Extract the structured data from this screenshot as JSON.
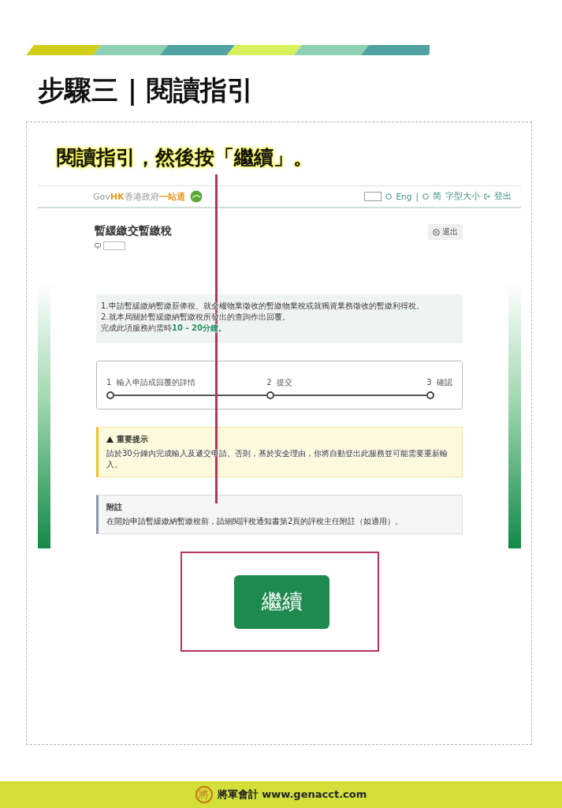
{
  "heading": "步驟三 | 閱讀指引",
  "callout": "閱讀指引，然後按「繼續」。",
  "site_header": {
    "logo": [
      {
        "text": "Gov",
        "highlight": false
      },
      {
        "text": "HK",
        "highlight": true
      },
      {
        "text": "香港政府",
        "highlight": false
      },
      {
        "text": "一站通",
        "highlight": true
      }
    ],
    "links": [
      {
        "kind": "lang",
        "label": "Eng"
      },
      {
        "kind": "sep",
        "label": "|"
      },
      {
        "kind": "lang",
        "label": "简"
      },
      {
        "kind": "font",
        "label": "字型大小"
      },
      {
        "kind": "logout",
        "label": "登出"
      }
    ]
  },
  "page": {
    "title": "暫緩繳交暫繳稅",
    "exit_button": "退出"
  },
  "info": {
    "lines": [
      "1.申請暫緩繳納暫繳薪俸稅、就全權物業徵收的暫繳物業稅或就獨資業務徵收的暫繳利得稅。",
      "2.就本局關於暫緩繳納暫繳稅所發出的查詢作出回覆。"
    ],
    "duration_prefix": "完成此項服務約需時",
    "duration": "10 - 20分鐘。"
  },
  "steps": [
    {
      "number": "1",
      "label": "輸入申請或回覆的詳情"
    },
    {
      "number": "2",
      "label": "提交"
    },
    {
      "number": "3",
      "label": "確認"
    }
  ],
  "warning": {
    "title": "重要提示",
    "text": "請於30分鐘內完成輸入及遞交申請。否則，基於安全理由，你將自動登出此服務並可能需要重新輸入。"
  },
  "note": {
    "title": "附註",
    "text": "在開始申請暫緩繳納暫繳稅前，請細閱評稅通知書第2頁的評稅主任附註（如適用）。"
  },
  "continue_button": "繼續",
  "footer": {
    "logo_mark": "將",
    "brand": "將軍會計",
    "url": "www.genacct.com"
  }
}
